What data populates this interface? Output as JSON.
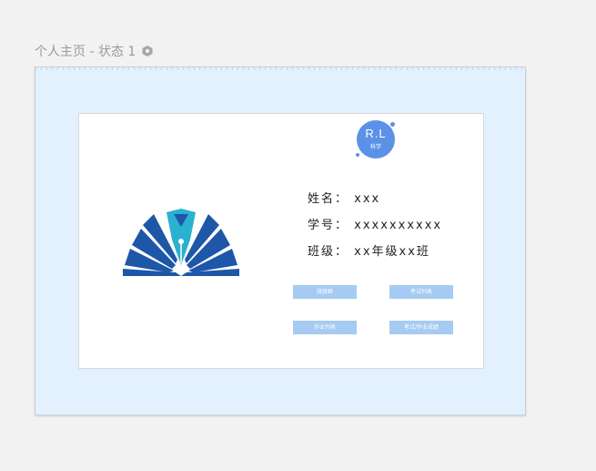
{
  "page": {
    "state_title": "个人主页 - 状态 1"
  },
  "avatar": {
    "main": "R.L",
    "sub": "科学"
  },
  "profile": {
    "name_label": "姓名：",
    "name_value": "xxx",
    "id_label": "学号：",
    "id_value": "xxxxxxxxxx",
    "class_label": "班级：",
    "class_value": "xx年级xx班"
  },
  "buttons": {
    "class_circle": "班级群",
    "exam_list": "考试列表",
    "homework_list": "作业列表",
    "scores": "考试/作业成绩"
  },
  "colors": {
    "canvas_bg": "#e3f1ff",
    "button_bg": "#a6cbf2",
    "avatar_bg": "#5b92e8",
    "logo_dark_blue": "#1e56a8",
    "logo_light_blue": "#2ab0d0"
  },
  "icons": {
    "state": "state-hexagon-icon",
    "logo": "open-book-pen-logo"
  }
}
